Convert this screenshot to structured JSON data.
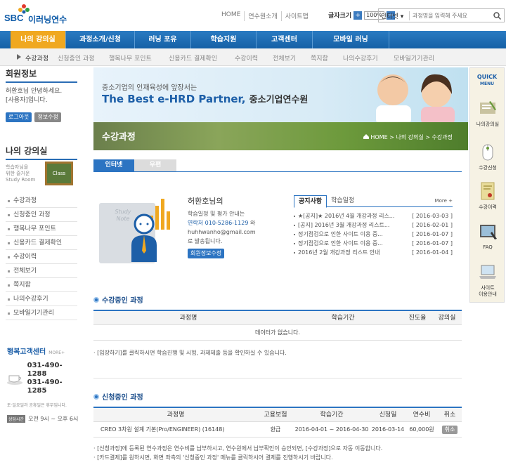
{
  "header": {
    "logo_brand": "SBC",
    "logo_name": "이러닝연수",
    "links": [
      "HOME",
      "연수원소개",
      "사이트맵"
    ],
    "font_size_label": "글자크기",
    "font_size_value": "100%",
    "search_scope": "인터넷",
    "search_placeholder": "과정명을 입력해 주세요"
  },
  "gnb": [
    "나의 강의실",
    "과정소개/신청",
    "러닝 포유",
    "학습지원",
    "고객센터",
    "모바일 러닝"
  ],
  "lnb": [
    "수강과정",
    "신청중인 과정",
    "행복나무 포인트",
    "신용카드 결제확인",
    "수강이력",
    "전체보기",
    "쪽지함",
    "나의수강후기",
    "모바일기기관리"
  ],
  "member": {
    "title": "회원정보",
    "greeting": "허환호님 안녕하세요.",
    "role": "[사용자]입니다.",
    "logout": "로그아웃",
    "edit": "정보수정"
  },
  "classroom": {
    "title": "나의 강의실",
    "desc1": "학습자님을",
    "desc2": "위한 즐거운",
    "desc3": "Study Room",
    "board": "Class",
    "menu": [
      "수강과정",
      "신청중인 과정",
      "행복나무 포인트",
      "신용카드 결제확인",
      "수강이력",
      "전체보기",
      "쪽지함",
      "나의수강후기",
      "모바일기기관리"
    ]
  },
  "cs": {
    "title": "행복고객센터",
    "more": "MORE+",
    "phone1": "031-490-1288",
    "phone2": "031-490-1285",
    "holiday": "토·일요일과 공휴일은 휴무입니다.",
    "hours_badge": "상담시간",
    "hours": "오전 9시 ~ 오후 6시"
  },
  "banner": {
    "sub": "중소기업의 인재육성에 앞장서는",
    "main_a": "The Best e-HRD Partner,",
    "main_b": "중소기업연수원",
    "page_title": "수강과정",
    "crumb": "HOME > 나의 강의실 > 수강과정"
  },
  "tabs": [
    "인터넷",
    "우편"
  ],
  "profile": {
    "study_note": "Study Note",
    "name": "허환호님의",
    "l1": "학습일정 및 평가 안내는",
    "l2a": "연락처",
    "l2b": "010-5286-1129",
    "l2c": "와",
    "l3": "huhhwanho@gmail.com",
    "l4": "로 발송됩니다.",
    "btn": "회원정보수정"
  },
  "notice": {
    "tab_on": "공지사항",
    "tab_off": "학습일정",
    "more": "More +",
    "items": [
      {
        "t": "★[공지]★ 2016년 4월 개강과정 리스...",
        "d": "[ 2016-03-03 ]"
      },
      {
        "t": "[공지] 2016년 3월 개강과정 리스트...",
        "d": "[ 2016-02-01 ]"
      },
      {
        "t": "정기점검으로 인한 사이트 이용 중...",
        "d": "[ 2016-01-07 ]"
      },
      {
        "t": "정기점검으로 인한 사이트 이용 중...",
        "d": "[ 2016-01-07 ]"
      },
      {
        "t": "2016년 2월 개강과정 리스트 안내",
        "d": "[ 2016-01-04 ]"
      }
    ]
  },
  "ongoing": {
    "title": "수강중인 과정",
    "cols": [
      "과정명",
      "학습기간",
      "진도율",
      "강의실"
    ],
    "empty": "데이터가 없습니다.",
    "note": "[입장하기]를 클릭하시면 학습진행 및 시험, 과제제출 등을 확인하실 수 있습니다."
  },
  "applying": {
    "title": "신청중인 과정",
    "cols": [
      "과정명",
      "고용보험",
      "학습기간",
      "신청일",
      "연수비",
      "취소"
    ],
    "row": {
      "name": "CREO 3차원 설계 기본(Pro/ENGINEER) (16148)",
      "ins": "환급",
      "period": "2016-04-01 ~ 2016-04-30",
      "date": "2016-03-14",
      "fee": "60,000원",
      "cancel": "취소"
    },
    "note1": "[신청과정]에 등록된 연수과정은 연수비를 납부하시고, 연수원에서 납부확인이 승인되면, [수강과정]으로 자동 이동합니다.",
    "note2": "[카드결제]를 원하시면, 화면 좌측의 '신청중인 과정' 메뉴를 클릭하시어 결제를 진행하시기 바랍니다."
  },
  "quick": {
    "title1": "QUICK",
    "title2": "MENU",
    "items": [
      "나의강의실",
      "수강신청",
      "수강이력",
      "FAQ",
      "사이트\n이용안내"
    ]
  },
  "colors": {
    "brand": "#1d5fa8",
    "gnb": "#1f6db5",
    "active": "#f0a820"
  }
}
